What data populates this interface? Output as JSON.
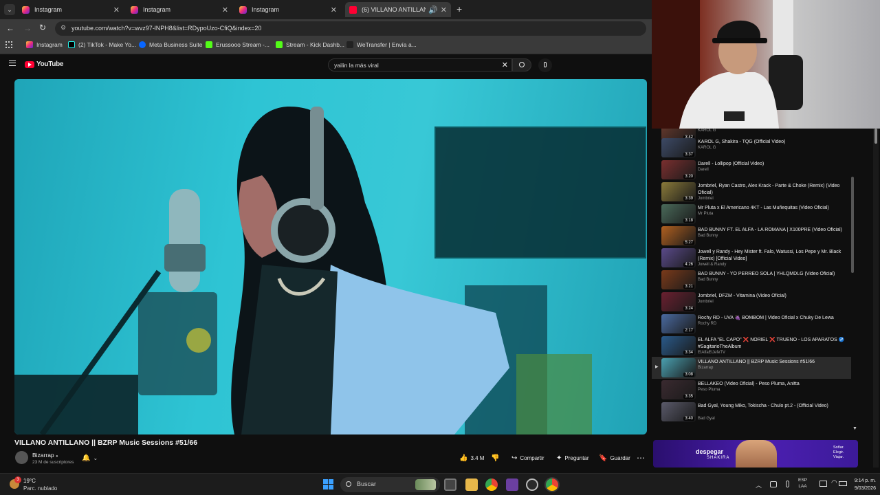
{
  "tabs": [
    {
      "title": "Instagram",
      "active": false
    },
    {
      "title": "Instagram",
      "active": false
    },
    {
      "title": "Instagram",
      "active": false
    },
    {
      "title": "(6) VILLANO ANTILLANO ||",
      "active": true
    }
  ],
  "address": {
    "url": "youtube.com/watch?v=wvz97-lNPH8&list=RDypoUzo-CfiQ&index=20"
  },
  "bookmarks": [
    "Instagram",
    "(2) TikTok - Make Yo...",
    "Meta Business Suite",
    "Erussooo Stream -...",
    "Stream - Kick Dashb...",
    "WeTransfer | Envía a..."
  ],
  "youtube": {
    "logo": "YouTube",
    "search_value": "yailin la más viral"
  },
  "video": {
    "title": "VILLANO ANTILLANO || BZRP Music Sessions #51/66",
    "channel": "Bizarrap",
    "subscribers": "23 M de suscriptores",
    "likes": "3.4 M",
    "share_label": "Compartir",
    "ask_label": "Preguntar",
    "save_label": "Guardar"
  },
  "playlist": [
    {
      "title": "",
      "channel": "KAROL G",
      "duration": "3:42"
    },
    {
      "title": "KAROL G, Shakira - TQG (Official Video)",
      "channel": "KAROL G",
      "duration": "3:37"
    },
    {
      "title": "Darell - Lollipop (Official Video)",
      "channel": "Darell",
      "duration": "3:20"
    },
    {
      "title": "Jombriel, Ryan Castro, Alex Krack - Parte & Choke (Remix) (Video Oficial)",
      "channel": "Jombriel",
      "duration": "3:39"
    },
    {
      "title": "Mr Pluta x El Americano 4KT - Las Muñequitas (Video Oficial)",
      "channel": "Mr Pluta",
      "duration": "3:18"
    },
    {
      "title": "BAD BUNNY FT. EL ALFA - LA ROMANA | X100PRE (Video Oficial)",
      "channel": "Bad Bunny",
      "duration": "5:27"
    },
    {
      "title": "Jowell y Randy - Hey Mister ft. Falo, Watussi, Los Pepe y Mr. Black (Remix) [Official Video]",
      "channel": "Jowell & Randy",
      "duration": "4:26"
    },
    {
      "title": "BAD BUNNY - YO PERREO SOLA | YHLQMDLG (Video Oficial)",
      "channel": "Bad Bunny",
      "duration": "3:21"
    },
    {
      "title": "Jombriel, DFZM - Vitamina (Video Oficial)",
      "channel": "Jombriel",
      "duration": "3:24"
    },
    {
      "title": "Rochy RD - UVA 🍇 BOMBOM | Video Oficial x Chuky De Lewa",
      "channel": "Rochy RD",
      "duration": "2:17"
    },
    {
      "title": "EL ALFA \"EL CAPO\" ❌ NORIEL ❌ TRUENO - LOS APARATOS ♐ #SagitarioTheAlbum",
      "channel": "ElAlfaElJefeTV",
      "duration": "3:34"
    },
    {
      "title": "VILLANO ANTILLANO || BZRP Music Sessions #51/66",
      "channel": "Bizarrap",
      "duration": "3:08",
      "current": true
    },
    {
      "title": "BELLAKEO (Video Oficial) - Peso Pluma, Anitta",
      "channel": "Peso Pluma",
      "duration": "3:35"
    },
    {
      "title": "Bad Gyal, Young Miko, Tokischa - Chulo pt.2 - (Official Video)",
      "channel": "Bad Gyal",
      "duration": "3:40"
    }
  ],
  "ad": {
    "brand": "despegar",
    "partner": "SHAKIRA",
    "tagline": "Soñar. Elegir. Viajar."
  },
  "taskbar": {
    "weather_temp": "19°C",
    "weather_desc": "Parc. nublado",
    "weather_badge": "3",
    "search_label": "Buscar",
    "lang_top": "ESP",
    "lang_bottom": "LAA",
    "time": "9:14 p. m.",
    "date": "9/03/2026"
  }
}
